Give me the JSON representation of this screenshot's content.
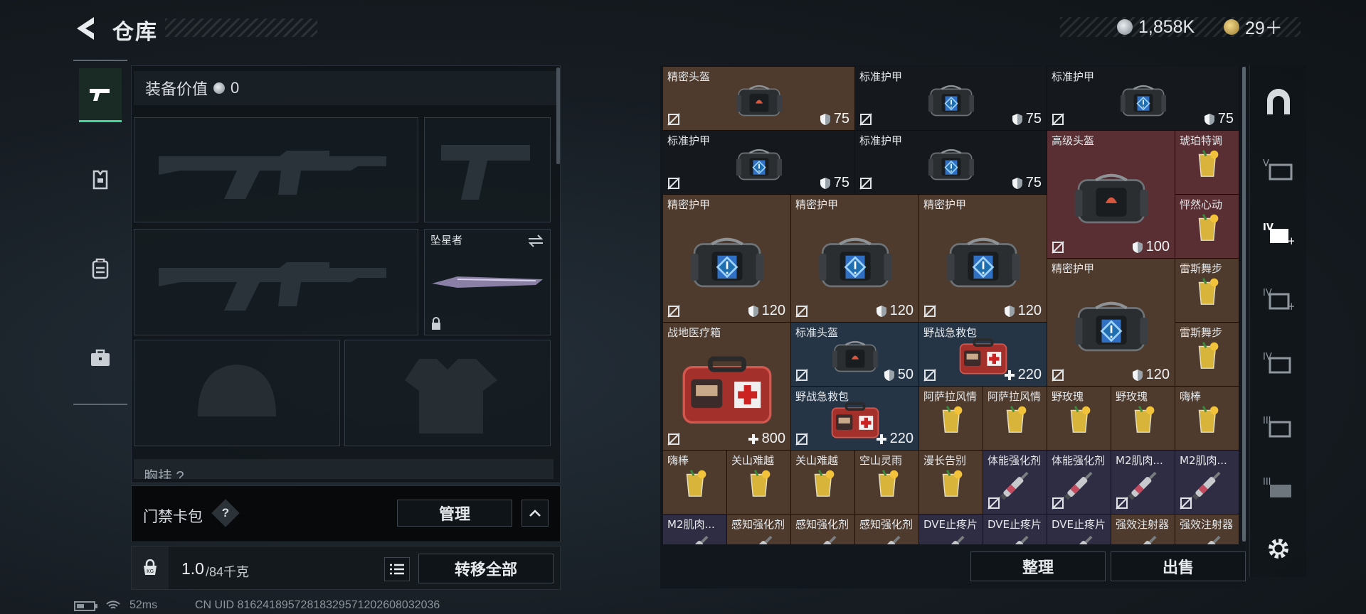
{
  "header": {
    "title": "仓库",
    "currency_silver": "1,858K",
    "currency_gold": "29＋"
  },
  "equipment": {
    "value_label": "装备价值",
    "value": "0",
    "melee_name": "坠星者",
    "chest_label_cut": "胸挂 ?"
  },
  "keycard": {
    "label": "门禁卡包",
    "help": "?",
    "manage_label": "管理"
  },
  "weight": {
    "current": "1.0",
    "capacity": "/84千克",
    "transfer_all_label": "转移全部"
  },
  "grid": {
    "items": [
      {
        "name": "精密头盔",
        "value": "75",
        "kind": "helmet",
        "tier": "orange",
        "icon": "helmet-bag-icon"
      },
      {
        "name": "标准护甲",
        "value": "75",
        "kind": "armor",
        "tier": "dark",
        "icon": "armor-bag-icon"
      },
      {
        "name": "标准护甲",
        "value": "75",
        "kind": "armor",
        "tier": "dark",
        "icon": "armor-bag-icon"
      },
      {
        "name": "标准护甲",
        "value": "75",
        "kind": "armor",
        "tier": "dark",
        "icon": "armor-bag-icon"
      },
      {
        "name": "标准护甲",
        "value": "75",
        "kind": "armor",
        "tier": "dark",
        "icon": "armor-bag-icon"
      },
      {
        "name": "高级头盔",
        "value": "100",
        "kind": "helmet",
        "tier": "red",
        "icon": "helmet-bag-icon"
      },
      {
        "name": "琥珀特调",
        "value": "",
        "kind": "drink",
        "tier": "red",
        "icon": "cocktail-icon"
      },
      {
        "name": "怦然心动",
        "value": "",
        "kind": "drink",
        "tier": "red",
        "icon": "cocktail-icon"
      },
      {
        "name": "精密护甲",
        "value": "120",
        "kind": "armor",
        "tier": "orange",
        "icon": "armor-bag-icon"
      },
      {
        "name": "精密护甲",
        "value": "120",
        "kind": "armor",
        "tier": "orange",
        "icon": "armor-bag-icon"
      },
      {
        "name": "精密护甲",
        "value": "120",
        "kind": "armor",
        "tier": "orange",
        "icon": "armor-bag-icon"
      },
      {
        "name": "精密护甲",
        "value": "120",
        "kind": "armor",
        "tier": "orange",
        "icon": "armor-bag-icon"
      },
      {
        "name": "雷斯舞步",
        "value": "",
        "kind": "drink",
        "tier": "orange",
        "icon": "cocktail-icon"
      },
      {
        "name": "雷斯舞步",
        "value": "",
        "kind": "drink",
        "tier": "orange",
        "icon": "cocktail-icon"
      },
      {
        "name": "战地医疗箱",
        "value": "800",
        "kind": "medkit",
        "tier": "orange",
        "icon": "medkit-icon"
      },
      {
        "name": "标准头盔",
        "value": "50",
        "kind": "helmet",
        "tier": "blue",
        "icon": "helmet-bag-icon"
      },
      {
        "name": "野战急救包",
        "value": "220",
        "kind": "medkit",
        "tier": "blue",
        "icon": "medkit-icon"
      },
      {
        "name": "野战急救包",
        "value": "220",
        "kind": "medkit",
        "tier": "blue",
        "icon": "medkit-icon"
      },
      {
        "name": "阿萨拉风情",
        "value": "",
        "kind": "drink",
        "tier": "orange",
        "icon": "cocktail-icon"
      },
      {
        "name": "阿萨拉风情",
        "value": "",
        "kind": "drink",
        "tier": "orange",
        "icon": "cocktail-icon"
      },
      {
        "name": "野玫瑰",
        "value": "",
        "kind": "drink",
        "tier": "orange",
        "icon": "cocktail-icon"
      },
      {
        "name": "野玫瑰",
        "value": "",
        "kind": "drink",
        "tier": "orange",
        "icon": "cocktail-icon"
      },
      {
        "name": "嗨棒",
        "value": "",
        "kind": "drink",
        "tier": "orange",
        "icon": "cocktail-icon"
      },
      {
        "name": "嗨棒",
        "value": "",
        "kind": "drink",
        "tier": "orange",
        "icon": "cocktail-icon"
      },
      {
        "name": "关山难越",
        "value": "",
        "kind": "drink",
        "tier": "orange",
        "icon": "cocktail-icon"
      },
      {
        "name": "关山难越",
        "value": "",
        "kind": "drink",
        "tier": "orange",
        "icon": "cocktail-icon"
      },
      {
        "name": "空山灵雨",
        "value": "",
        "kind": "drink",
        "tier": "orange",
        "icon": "cocktail-icon"
      },
      {
        "name": "漫长告别",
        "value": "",
        "kind": "drink",
        "tier": "orange",
        "icon": "cocktail-icon"
      },
      {
        "name": "体能强化剂",
        "value": "",
        "kind": "injector",
        "tier": "purple",
        "icon": "syringe-icon"
      },
      {
        "name": "体能强化剂",
        "value": "",
        "kind": "injector",
        "tier": "purple",
        "icon": "syringe-icon"
      },
      {
        "name": "M2肌肉...",
        "value": "",
        "kind": "injector",
        "tier": "purple",
        "icon": "syringe-icon"
      },
      {
        "name": "M2肌肉...",
        "value": "",
        "kind": "injector",
        "tier": "purple",
        "icon": "syringe-icon"
      },
      {
        "name": "M2肌肉...",
        "value": "",
        "kind": "injector",
        "tier": "purple",
        "icon": "syringe-icon"
      },
      {
        "name": "感知强化剂",
        "value": "",
        "kind": "injector",
        "tier": "orange",
        "icon": "syringe-icon"
      },
      {
        "name": "感知强化剂",
        "value": "",
        "kind": "injector",
        "tier": "orange",
        "icon": "syringe-icon"
      },
      {
        "name": "感知强化剂",
        "value": "",
        "kind": "injector",
        "tier": "orange",
        "icon": "syringe-icon"
      },
      {
        "name": "DVE止疼片",
        "value": "",
        "kind": "injector",
        "tier": "purple",
        "icon": "syringe-icon"
      },
      {
        "name": "DVE止疼片",
        "value": "",
        "kind": "injector",
        "tier": "purple",
        "icon": "syringe-icon"
      },
      {
        "name": "DVE止疼片",
        "value": "",
        "kind": "injector",
        "tier": "purple",
        "icon": "syringe-icon"
      },
      {
        "name": "强效注射器",
        "value": "",
        "kind": "injector",
        "tier": "orange",
        "icon": "syringe-icon"
      },
      {
        "name": "强效注射器",
        "value": "",
        "kind": "injector",
        "tier": "orange",
        "icon": "syringe-icon"
      }
    ]
  },
  "actions": {
    "sort_label": "整理",
    "sell_label": "出售"
  },
  "status": {
    "ping": "52ms",
    "uid": "CN UID 816241895728183295712026080320​36"
  },
  "colors": {
    "accent_green": "#3fd79a",
    "tier_orange": "#4e3b2d",
    "tier_red": "#5a2f33",
    "tier_blue": "#263546",
    "tier_purple": "#2f2d43",
    "tier_dark": "#15191d"
  },
  "side_tabs": [
    "tier-v-icon",
    "tier-v-plus-icon",
    "tier-iv-plus-icon",
    "tier-iv-icon",
    "tier-iii-plus-icon",
    "tier-iii-icon"
  ]
}
